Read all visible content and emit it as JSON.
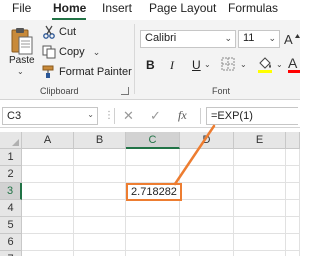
{
  "tabs": [
    "File",
    "Home",
    "Insert",
    "Page Layout",
    "Formulas"
  ],
  "active_tab": "Home",
  "clipboard": {
    "paste_label": "Paste",
    "cut_label": "Cut",
    "copy_label": "Copy",
    "format_painter_label": "Format Painter",
    "group_label": "Clipboard"
  },
  "font": {
    "name": "Calibri",
    "size": "11",
    "group_label": "Font"
  },
  "formula_bar": {
    "name_box": "C3",
    "formula": "=EXP(1)",
    "fx_label": "fx"
  },
  "columns": [
    "A",
    "B",
    "C",
    "D",
    "E"
  ],
  "rows": [
    "1",
    "2",
    "3",
    "4",
    "5",
    "6",
    "7"
  ],
  "selected_cell": "C3",
  "cell_value": "2.718282",
  "colors": {
    "accent": "#217346",
    "highlight": "#ed7d31",
    "font_color_bar": "#ff0000"
  }
}
